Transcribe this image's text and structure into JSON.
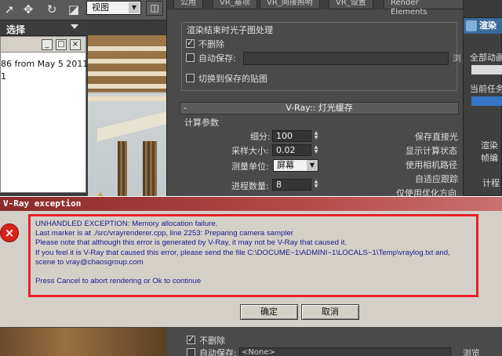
{
  "toolbar": {
    "view_select": "视图",
    "icons": [
      "cursor-icon",
      "move-icon",
      "rotate-icon",
      "scale-icon",
      "dropdown-arrow-icon"
    ]
  },
  "select_panel": {
    "label": "选择",
    "subwindow_buttons": [
      "_",
      "□",
      "×"
    ],
    "lines": [
      "86 from May  5 2011, 1",
      "1"
    ]
  },
  "settings": {
    "tabs": [
      "公用",
      "VR_基项",
      "VR_间接照明",
      "VR_设置",
      "Render Elements"
    ],
    "group_title": "渲染结束时光子图处理",
    "dont_delete": "不删除",
    "auto_save": "自动保存:",
    "browse": "浏",
    "switch_to_saved": "切换到保存的贴图",
    "rollout_title": "V-Ray:: 灯光缓存",
    "rollout_minus": "-",
    "calc_params": "计算参数",
    "subdivs_label": "细分:",
    "subdivs_value": "100",
    "sample_size_label": "采样大小:",
    "sample_size_value": "0.02",
    "scale_label": "测量单位:",
    "scale_value": "屏幕",
    "passes_label": "进程数量:",
    "passes_value": "8",
    "right_options": [
      "保存直接光",
      "显示计算状态",
      "使用相机路径",
      "自适应跟踪",
      "仅使用优化方向"
    ]
  },
  "status_window": {
    "title": "渲染",
    "lines": [
      "全部动画",
      "当前任务",
      "渲染",
      "帧编",
      "计程"
    ]
  },
  "dialog": {
    "title": "V-Ray exception",
    "error_icon": "×",
    "message_lines": [
      "UNHANDLED EXCEPTION: Memory allocation failure.",
      "Last marker is at ./src/vrayrenderer.cpp, line 2253: Preparing camera sampler",
      "Please note that although this error is generated by V-Ray, it may not be V-Ray that caused it.",
      "If you feel it is V-Ray that caused this error, please send the file C:\\DOCUME~1\\ADMINI~1\\LOCALS~1\\Temp\\vraylog.txt and,",
      "scene to vray@chaosgroup.com",
      "",
      "Press Cancel to abort rendering or Ok to continue"
    ],
    "ok_label": "确定",
    "cancel_label": "取消"
  },
  "bottom": {
    "dont_delete": "不删除",
    "auto_save": "自动保存:",
    "none_value": "<None>",
    "browse": "浏览"
  },
  "colors": {
    "dialog_bg": "#d4d0c8",
    "highlight_border": "#e8202a",
    "message_text": "#1a1a8a",
    "dialog_title": "#8a2a2a"
  }
}
